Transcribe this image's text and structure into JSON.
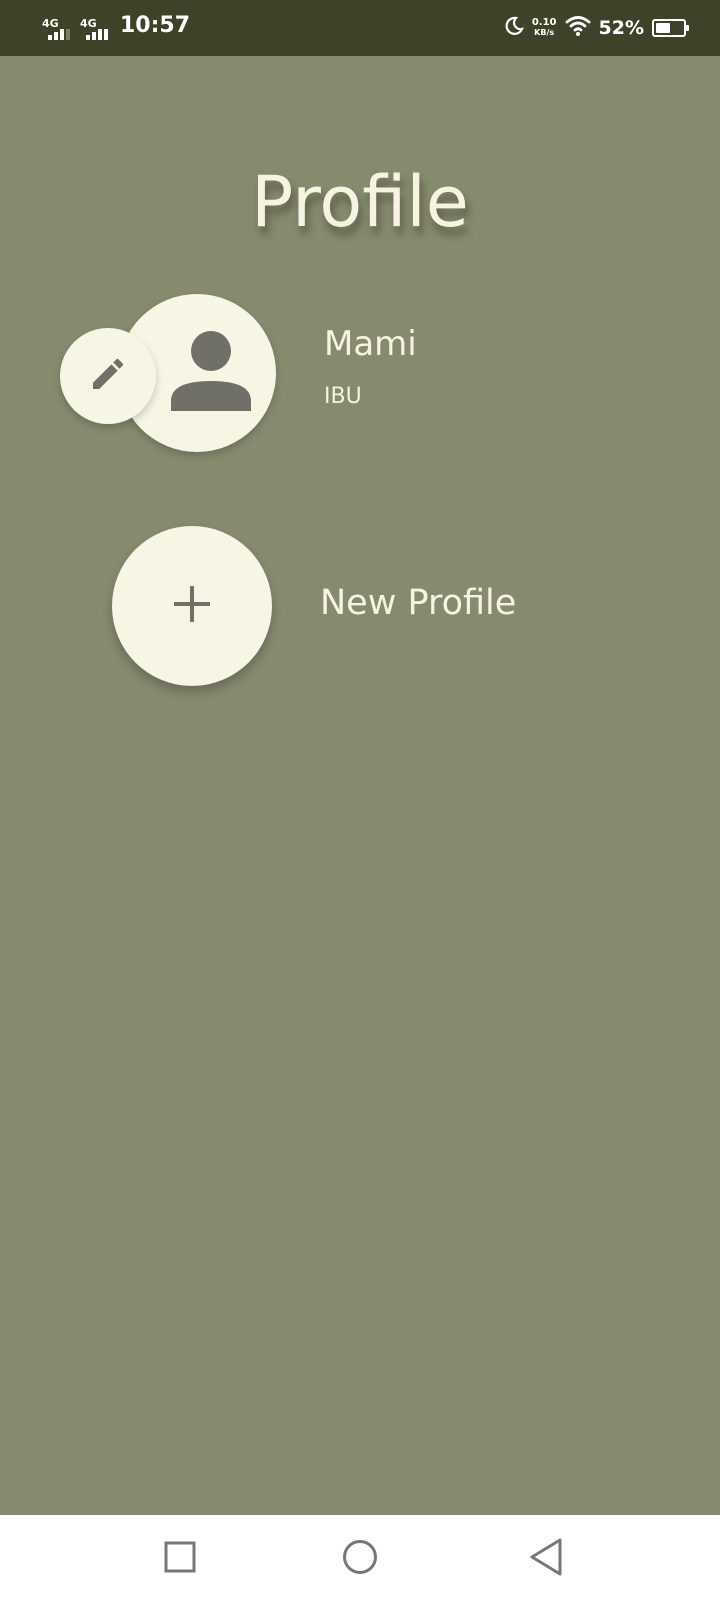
{
  "status_bar": {
    "network_1": "4G",
    "network_2": "4G",
    "time": "10:57",
    "speed_value": "0.10",
    "speed_unit": "KB/s",
    "battery_percent": "52%",
    "battery_level": 0.52
  },
  "page": {
    "title": "Profile"
  },
  "profiles": [
    {
      "name": "Mami",
      "role": "IBU"
    }
  ],
  "new_profile": {
    "label": "New Profile"
  },
  "colors": {
    "background": "#868a6f",
    "status_bar": "#3f4228",
    "circle_fill": "#f7f5e4",
    "icon": "#707068",
    "text": "#f6f3e2"
  },
  "icons": {
    "edit": "pencil-icon",
    "avatar": "person-icon",
    "add": "plus-icon",
    "nav_recents": "square-icon",
    "nav_home": "circle-icon",
    "nav_back": "triangle-back-icon"
  }
}
